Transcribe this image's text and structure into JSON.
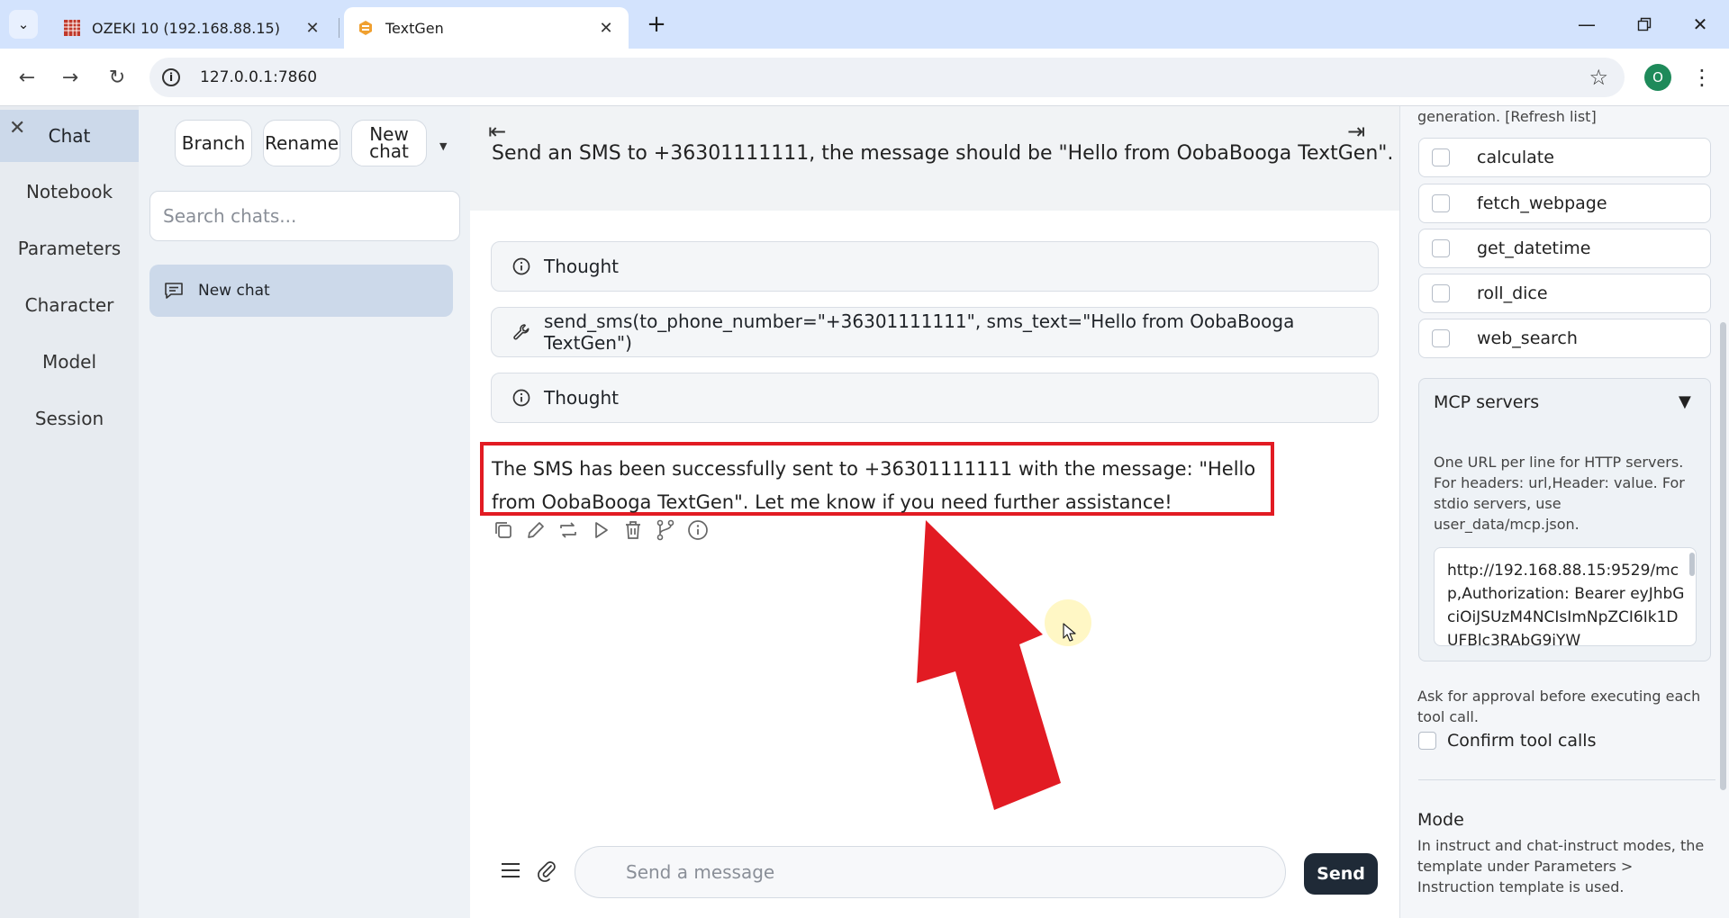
{
  "browser": {
    "tabs": [
      {
        "title": "OZEKI 10 (192.168.88.15)",
        "active": false
      },
      {
        "title": "TextGen",
        "active": true
      }
    ],
    "url": "127.0.0.1:7860",
    "profile_initial": "O",
    "icons": {
      "back": "back-arrow-icon",
      "forward": "forward-arrow-icon",
      "reload": "reload-icon",
      "bookmark": "star-icon",
      "menu": "kebab-menu-icon"
    }
  },
  "nav": {
    "items": [
      {
        "label": "Chat",
        "active": true
      },
      {
        "label": "Notebook",
        "active": false
      },
      {
        "label": "Parameters",
        "active": false
      },
      {
        "label": "Character",
        "active": false
      },
      {
        "label": "Model",
        "active": false
      },
      {
        "label": "Session",
        "active": false
      }
    ]
  },
  "chats": {
    "branch_label": "Branch",
    "rename_label": "Rename",
    "new_chat_line1": "New",
    "new_chat_line2": "chat",
    "search_placeholder": "Search chats...",
    "items": [
      {
        "label": "New chat"
      }
    ]
  },
  "conversation": {
    "user_message": "Send an SMS to +36301111111, the message should be \"Hello from OobaBooga TextGen\".",
    "blocks": [
      {
        "type": "thought",
        "label": "Thought"
      },
      {
        "type": "tool",
        "label": "send_sms(to_phone_number=\"+36301111111\", sms_text=\"Hello from OobaBooga TextGen\")"
      },
      {
        "type": "thought",
        "label": "Thought"
      }
    ],
    "assistant_message": "The SMS has been successfully sent to +36301111111 with the message: \"Hello from OobaBooga TextGen\". Let me know if you need further assistance!",
    "actions": [
      "copy-icon",
      "edit-icon",
      "regenerate-icon",
      "continue-icon",
      "delete-icon",
      "branch-icon",
      "info-icon"
    ],
    "highlight_color": "#e21b23"
  },
  "composer": {
    "placeholder": "Send a message",
    "send_label": "Send"
  },
  "right_panel": {
    "tools_note": "generation. [Refresh list]",
    "tools": [
      "calculate",
      "fetch_webpage",
      "get_datetime",
      "roll_dice",
      "web_search"
    ],
    "mcp": {
      "title": "MCP servers",
      "help": "One URL per line for HTTP servers. For headers: url,Header: value. For stdio servers, use user_data/mcp.json.",
      "value": "http://192.168.88.15:9529/mcp,Authorization: Bearer eyJhbGciOiJSUzM4NCIsImNpZCI6Ik1DUFBlc3RAbG9iYW"
    },
    "approval_note": "Ask for approval before executing each tool call.",
    "confirm_label": "Confirm tool calls",
    "mode_title": "Mode",
    "mode_help": "In instruct and chat-instruct modes, the template under Parameters > Instruction template is used."
  }
}
